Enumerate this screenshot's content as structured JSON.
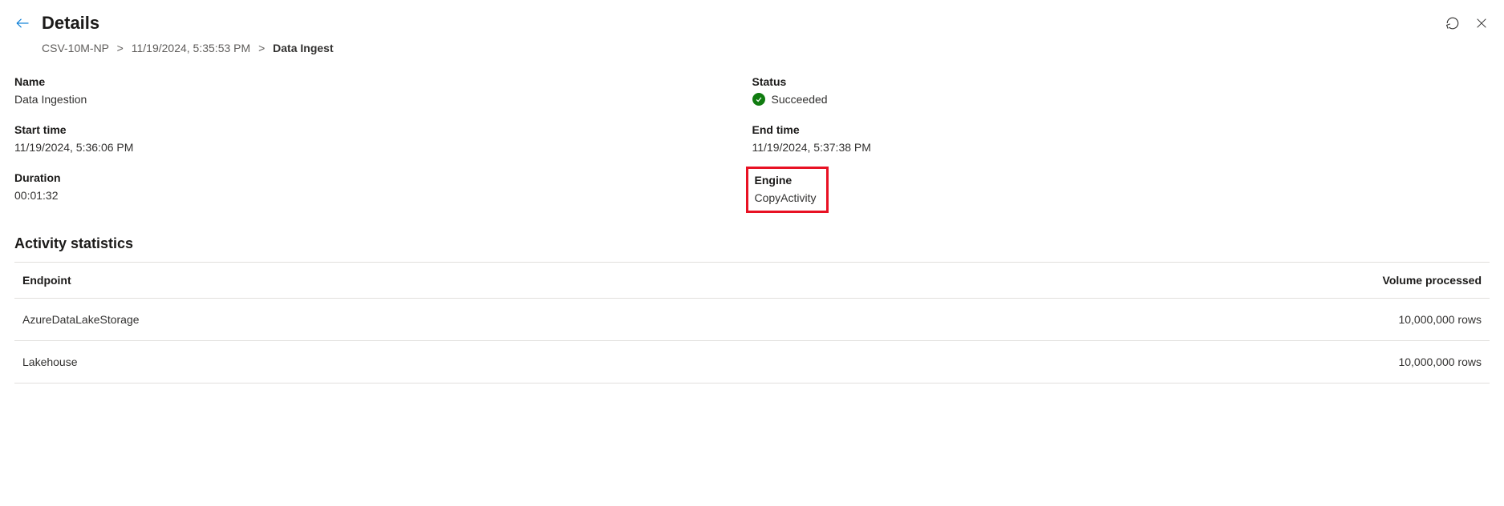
{
  "header": {
    "title": "Details"
  },
  "breadcrumb": {
    "item0": "CSV-10M-NP",
    "item1": "11/19/2024, 5:35:53 PM",
    "current": "Data Ingest"
  },
  "props": {
    "name_label": "Name",
    "name_value": "Data Ingestion",
    "status_label": "Status",
    "status_value": "Succeeded",
    "start_label": "Start time",
    "start_value": "11/19/2024, 5:36:06 PM",
    "end_label": "End time",
    "end_value": "11/19/2024, 5:37:38 PM",
    "duration_label": "Duration",
    "duration_value": "00:01:32",
    "engine_label": "Engine",
    "engine_value": "CopyActivity"
  },
  "activity": {
    "section_title": "Activity statistics",
    "col_endpoint": "Endpoint",
    "col_volume": "Volume processed",
    "rows": [
      {
        "endpoint": "AzureDataLakeStorage",
        "volume": "10,000,000 rows"
      },
      {
        "endpoint": "Lakehouse",
        "volume": "10,000,000 rows"
      }
    ]
  }
}
